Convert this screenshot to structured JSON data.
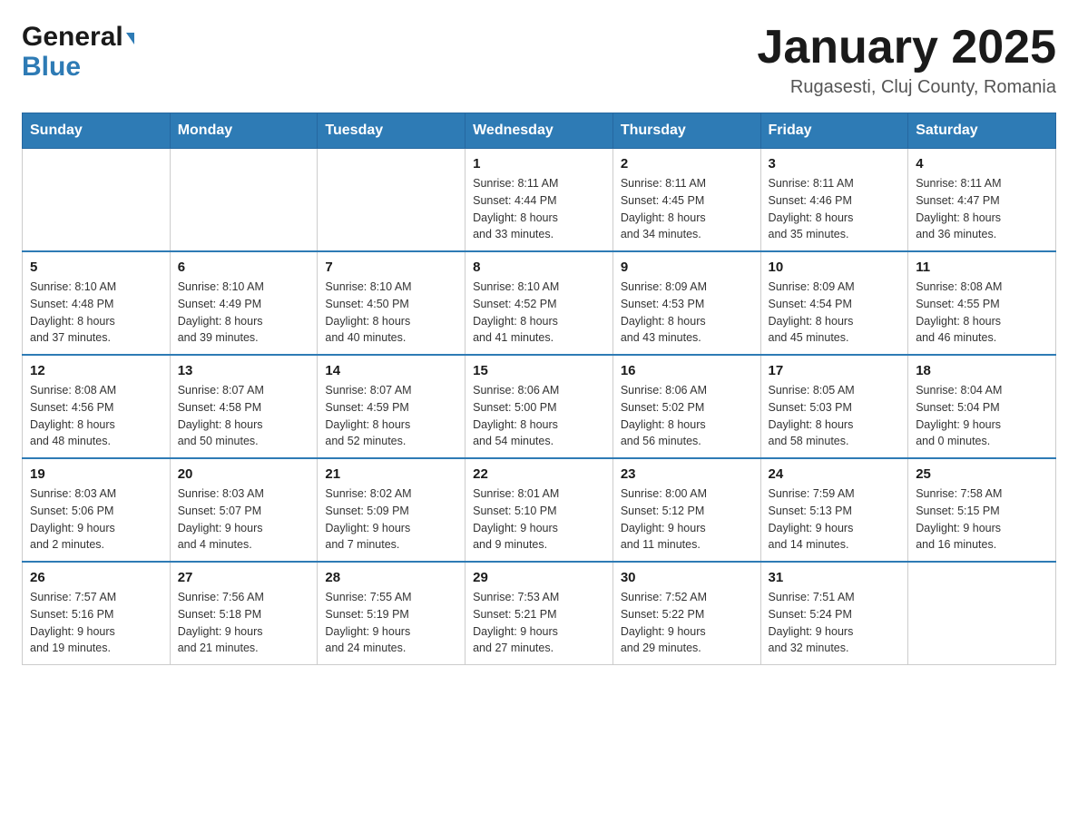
{
  "header": {
    "logo_general": "General",
    "logo_blue": "Blue",
    "title": "January 2025",
    "subtitle": "Rugasesti, Cluj County, Romania"
  },
  "weekdays": [
    "Sunday",
    "Monday",
    "Tuesday",
    "Wednesday",
    "Thursday",
    "Friday",
    "Saturday"
  ],
  "weeks": [
    [
      {
        "day": "",
        "info": ""
      },
      {
        "day": "",
        "info": ""
      },
      {
        "day": "",
        "info": ""
      },
      {
        "day": "1",
        "info": "Sunrise: 8:11 AM\nSunset: 4:44 PM\nDaylight: 8 hours\nand 33 minutes."
      },
      {
        "day": "2",
        "info": "Sunrise: 8:11 AM\nSunset: 4:45 PM\nDaylight: 8 hours\nand 34 minutes."
      },
      {
        "day": "3",
        "info": "Sunrise: 8:11 AM\nSunset: 4:46 PM\nDaylight: 8 hours\nand 35 minutes."
      },
      {
        "day": "4",
        "info": "Sunrise: 8:11 AM\nSunset: 4:47 PM\nDaylight: 8 hours\nand 36 minutes."
      }
    ],
    [
      {
        "day": "5",
        "info": "Sunrise: 8:10 AM\nSunset: 4:48 PM\nDaylight: 8 hours\nand 37 minutes."
      },
      {
        "day": "6",
        "info": "Sunrise: 8:10 AM\nSunset: 4:49 PM\nDaylight: 8 hours\nand 39 minutes."
      },
      {
        "day": "7",
        "info": "Sunrise: 8:10 AM\nSunset: 4:50 PM\nDaylight: 8 hours\nand 40 minutes."
      },
      {
        "day": "8",
        "info": "Sunrise: 8:10 AM\nSunset: 4:52 PM\nDaylight: 8 hours\nand 41 minutes."
      },
      {
        "day": "9",
        "info": "Sunrise: 8:09 AM\nSunset: 4:53 PM\nDaylight: 8 hours\nand 43 minutes."
      },
      {
        "day": "10",
        "info": "Sunrise: 8:09 AM\nSunset: 4:54 PM\nDaylight: 8 hours\nand 45 minutes."
      },
      {
        "day": "11",
        "info": "Sunrise: 8:08 AM\nSunset: 4:55 PM\nDaylight: 8 hours\nand 46 minutes."
      }
    ],
    [
      {
        "day": "12",
        "info": "Sunrise: 8:08 AM\nSunset: 4:56 PM\nDaylight: 8 hours\nand 48 minutes."
      },
      {
        "day": "13",
        "info": "Sunrise: 8:07 AM\nSunset: 4:58 PM\nDaylight: 8 hours\nand 50 minutes."
      },
      {
        "day": "14",
        "info": "Sunrise: 8:07 AM\nSunset: 4:59 PM\nDaylight: 8 hours\nand 52 minutes."
      },
      {
        "day": "15",
        "info": "Sunrise: 8:06 AM\nSunset: 5:00 PM\nDaylight: 8 hours\nand 54 minutes."
      },
      {
        "day": "16",
        "info": "Sunrise: 8:06 AM\nSunset: 5:02 PM\nDaylight: 8 hours\nand 56 minutes."
      },
      {
        "day": "17",
        "info": "Sunrise: 8:05 AM\nSunset: 5:03 PM\nDaylight: 8 hours\nand 58 minutes."
      },
      {
        "day": "18",
        "info": "Sunrise: 8:04 AM\nSunset: 5:04 PM\nDaylight: 9 hours\nand 0 minutes."
      }
    ],
    [
      {
        "day": "19",
        "info": "Sunrise: 8:03 AM\nSunset: 5:06 PM\nDaylight: 9 hours\nand 2 minutes."
      },
      {
        "day": "20",
        "info": "Sunrise: 8:03 AM\nSunset: 5:07 PM\nDaylight: 9 hours\nand 4 minutes."
      },
      {
        "day": "21",
        "info": "Sunrise: 8:02 AM\nSunset: 5:09 PM\nDaylight: 9 hours\nand 7 minutes."
      },
      {
        "day": "22",
        "info": "Sunrise: 8:01 AM\nSunset: 5:10 PM\nDaylight: 9 hours\nand 9 minutes."
      },
      {
        "day": "23",
        "info": "Sunrise: 8:00 AM\nSunset: 5:12 PM\nDaylight: 9 hours\nand 11 minutes."
      },
      {
        "day": "24",
        "info": "Sunrise: 7:59 AM\nSunset: 5:13 PM\nDaylight: 9 hours\nand 14 minutes."
      },
      {
        "day": "25",
        "info": "Sunrise: 7:58 AM\nSunset: 5:15 PM\nDaylight: 9 hours\nand 16 minutes."
      }
    ],
    [
      {
        "day": "26",
        "info": "Sunrise: 7:57 AM\nSunset: 5:16 PM\nDaylight: 9 hours\nand 19 minutes."
      },
      {
        "day": "27",
        "info": "Sunrise: 7:56 AM\nSunset: 5:18 PM\nDaylight: 9 hours\nand 21 minutes."
      },
      {
        "day": "28",
        "info": "Sunrise: 7:55 AM\nSunset: 5:19 PM\nDaylight: 9 hours\nand 24 minutes."
      },
      {
        "day": "29",
        "info": "Sunrise: 7:53 AM\nSunset: 5:21 PM\nDaylight: 9 hours\nand 27 minutes."
      },
      {
        "day": "30",
        "info": "Sunrise: 7:52 AM\nSunset: 5:22 PM\nDaylight: 9 hours\nand 29 minutes."
      },
      {
        "day": "31",
        "info": "Sunrise: 7:51 AM\nSunset: 5:24 PM\nDaylight: 9 hours\nand 32 minutes."
      },
      {
        "day": "",
        "info": ""
      }
    ]
  ]
}
